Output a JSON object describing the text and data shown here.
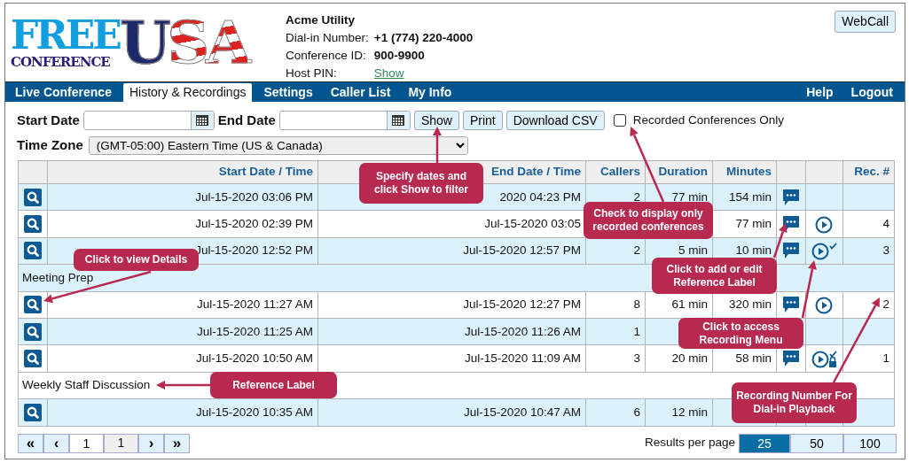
{
  "logo": {
    "line_1": "FREE",
    "line_2": "CONFERENCE",
    "line_3": "USA"
  },
  "account": {
    "name": "Acme Utility",
    "details": [
      {
        "label": "Dial-in Number:",
        "value": "+1 (774) 220-4000",
        "kind": "text"
      },
      {
        "label": "Conference ID:",
        "value": "900-9900",
        "kind": "text"
      },
      {
        "label": "Host PIN:",
        "value": "Show",
        "kind": "link"
      }
    ]
  },
  "webcall_button": "WebCall",
  "nav": {
    "tabs": [
      {
        "label": "Live Conference",
        "selected": false
      },
      {
        "label": "History & Recordings",
        "selected": true
      },
      {
        "label": "Settings",
        "selected": false
      },
      {
        "label": "Caller List",
        "selected": false
      },
      {
        "label": "My Info",
        "selected": false
      }
    ],
    "right_links": [
      "Help",
      "Logout"
    ]
  },
  "filters": {
    "start_date_label": "Start Date",
    "end_date_label": "End Date",
    "buttons": [
      "Show",
      "Print",
      "Download CSV"
    ],
    "recorded_only": {
      "label": "Recorded Conferences Only",
      "checked": false
    },
    "time_zone_label": "Time Zone",
    "time_zone": "(GMT-05:00) Eastern Time (US & Canada)"
  },
  "table": {
    "columns": [
      "Start Date / Time",
      "End Date / Time",
      "Callers",
      "Duration",
      "Minutes",
      "Rec. #"
    ],
    "rows": [
      {
        "kind": "call",
        "start": "Jul-15-2020 03:06 PM",
        "end": "2020 04:23 PM",
        "callers": "2",
        "duration": "77 min",
        "minutes": "154 min",
        "comment": true,
        "recording": false
      },
      {
        "kind": "call",
        "start": "Jul-15-2020 02:39 PM",
        "end": "Jul-15-2020 03:05",
        "minutes": "77 min",
        "comment": true,
        "recording": true,
        "recording_checked": false,
        "recording_locked": false,
        "rec_no": "4"
      },
      {
        "kind": "call",
        "start": "Jul-15-2020 12:52 PM",
        "end": "Jul-15-2020 12:57 PM",
        "callers": "2",
        "duration": "5 min",
        "minutes": "10 min",
        "comment": true,
        "recording": true,
        "recording_checked": true,
        "recording_locked": false,
        "rec_no": "3"
      },
      {
        "kind": "label",
        "text": "Meeting Prep"
      },
      {
        "kind": "call",
        "start": "Jul-15-2020 11:27 AM",
        "end": "Jul-15-2020 12:27 PM",
        "callers": "8",
        "duration": "61 min",
        "minutes": "320 min",
        "comment": true,
        "recording": true,
        "recording_checked": false,
        "recording_locked": false,
        "rec_no": "2"
      },
      {
        "kind": "call",
        "start": "Jul-15-2020 11:25 AM",
        "end": "Jul-15-2020 11:26 AM",
        "callers": "1",
        "recording": false
      },
      {
        "kind": "call",
        "start": "Jul-15-2020 10:50 AM",
        "end": "Jul-15-2020 11:09 AM",
        "callers": "3",
        "duration": "20 min",
        "minutes": "58 min",
        "comment": true,
        "recording": true,
        "recording_checked": true,
        "recording_locked": true,
        "rec_no": "1"
      },
      {
        "kind": "label",
        "text": "Weekly Staff Discussion"
      },
      {
        "kind": "call",
        "start": "Jul-15-2020 10:35 AM",
        "end": "Jul-15-2020 10:47 AM",
        "callers": "6",
        "duration": "12 min"
      }
    ]
  },
  "pagination": {
    "first": "«",
    "prev": "‹",
    "page": "1",
    "total": "1",
    "next": "›",
    "last": "»"
  },
  "results_per_page": {
    "label": "Results per page",
    "options": [
      {
        "label": "25",
        "selected": true
      },
      {
        "label": "50",
        "selected": false
      },
      {
        "label": "100",
        "selected": false
      }
    ]
  },
  "callouts": [
    {
      "text": "Specify dates and click Show to filter"
    },
    {
      "text": "Check to display only recorded conferences"
    },
    {
      "text": "Click to view Details"
    },
    {
      "text": "Click to add or edit Reference Label"
    },
    {
      "text": "Click to access Recording Menu"
    },
    {
      "text": "Reference Label"
    },
    {
      "text": "Recording Number For Dial-in Playback"
    }
  ]
}
